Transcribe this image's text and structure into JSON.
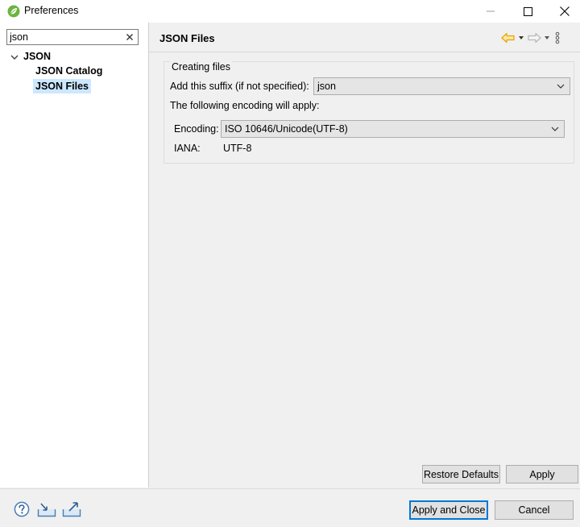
{
  "window": {
    "title": "Preferences"
  },
  "sidebar": {
    "filter_value": "json",
    "tree": {
      "root_label": "JSON",
      "children": [
        "JSON Catalog",
        "JSON Files"
      ],
      "selected": "JSON Files"
    }
  },
  "page": {
    "title": "JSON Files",
    "group_title": "Creating files",
    "suffix_label": "Add this suffix (if not specified):",
    "suffix_value": "json",
    "encoding_note": "The following encoding will apply:",
    "encoding_label": "Encoding:",
    "encoding_value": "ISO 10646/Unicode(UTF-8)",
    "iana_label": "IANA:",
    "iana_value": "UTF-8",
    "restore_defaults_label": "Restore Defaults",
    "apply_label": "Apply"
  },
  "footer": {
    "apply_close_label": "Apply and Close",
    "cancel_label": "Cancel"
  },
  "icons": {
    "app": "spring-leaf-icon",
    "minimize": "minimize-icon",
    "maximize": "maximize-icon",
    "close": "close-icon",
    "clear_filter": "clear-filter-icon",
    "back": "back-arrow-icon",
    "forward": "forward-arrow-icon",
    "view_menu": "view-menu-icon",
    "help": "help-icon",
    "import": "import-icon",
    "export": "export-icon"
  },
  "colors": {
    "selection": "#cce8ff",
    "default_button_border": "#0078d7",
    "back_arrow": "#e8a200",
    "spring_green": "#6db33f"
  }
}
